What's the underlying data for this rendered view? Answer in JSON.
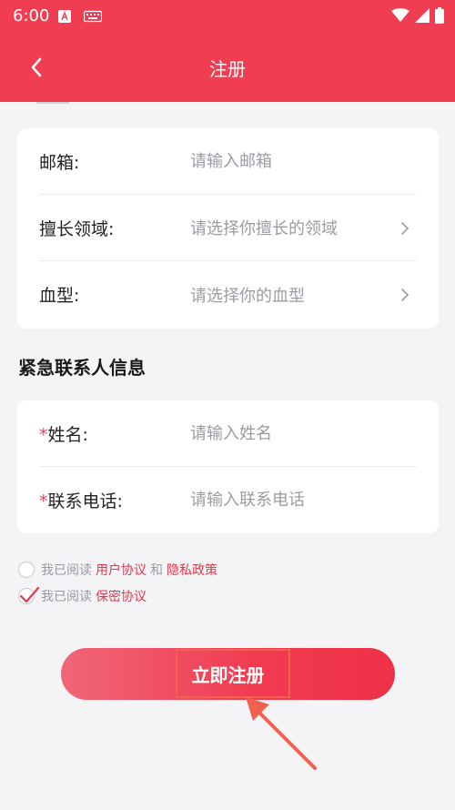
{
  "status_bar": {
    "time": "6:00"
  },
  "header": {
    "title": "注册"
  },
  "form_basic": [
    {
      "label": "邮箱:",
      "placeholder": "请输入邮箱",
      "type": "input"
    },
    {
      "label": "擅长领域:",
      "placeholder": "请选择你擅长的领域",
      "type": "select"
    },
    {
      "label": "血型:",
      "placeholder": "请选择你的血型",
      "type": "select"
    }
  ],
  "emergency": {
    "section_title": "紧急联系人信息",
    "required_mark": "*",
    "fields": [
      {
        "label": "姓名:",
        "placeholder": "请输入姓名"
      },
      {
        "label": "联系电话:",
        "placeholder": "请输入联系电话"
      }
    ]
  },
  "agreements": {
    "row1": {
      "prefix": "我已阅读",
      "link1": "用户协议",
      "conj": "和",
      "link2": "隐私政策",
      "checked": false
    },
    "row2": {
      "prefix": "我已阅读",
      "link1": "保密协议",
      "checked": true
    }
  },
  "submit": {
    "label": "立即注册"
  },
  "colors": {
    "brand": "#f13d52",
    "link": "#e8354b",
    "annotation": "#f0624f"
  }
}
